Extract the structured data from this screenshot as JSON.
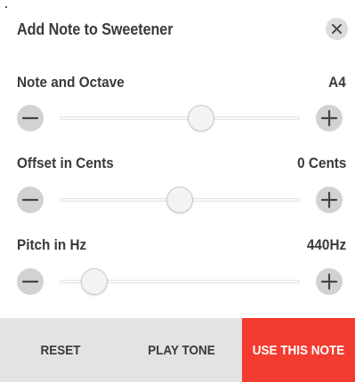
{
  "dialog": {
    "title": "Add Note to Sweetener",
    "close_icon": "close-icon"
  },
  "rows": [
    {
      "label": "Note and Octave",
      "value": "A4",
      "slider_fraction": 0.6
    },
    {
      "label": "Offset in Cents",
      "value": "0 Cents",
      "slider_fraction": 0.5
    },
    {
      "label": "Pitch in Hz",
      "value": "440Hz",
      "slider_fraction": 0.1
    }
  ],
  "icons": {
    "decrement": "minus-icon",
    "increment": "plus-icon"
  },
  "footer": {
    "reset_label": "RESET",
    "play_tone_label": "PLAY TONE",
    "use_note_label": "USE THIS NOTE"
  },
  "colors": {
    "primary_button": "#f43b30",
    "footer_background": "#e3e3e3",
    "round_button": "#d2d2d2",
    "text": "#3a3a3a"
  }
}
